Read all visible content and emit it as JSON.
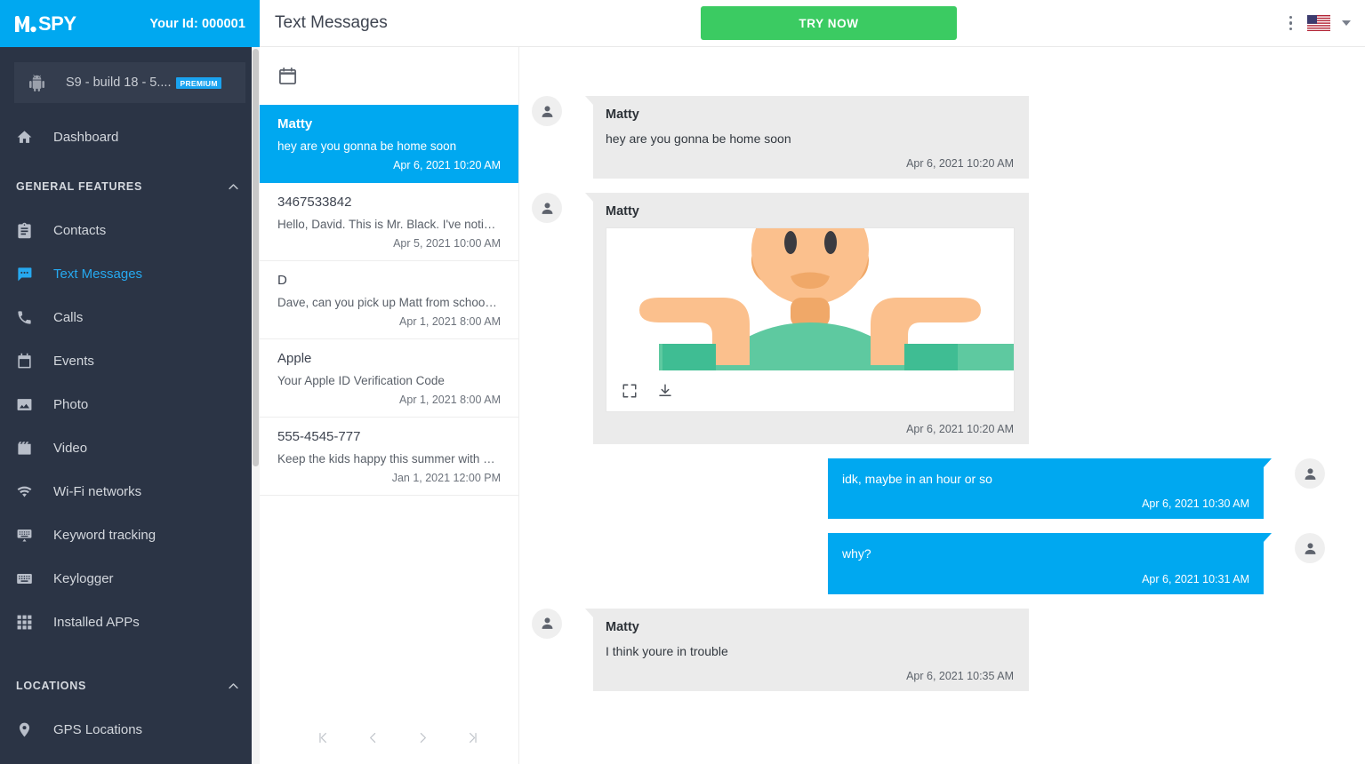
{
  "brand": {
    "logo_text": "SPY",
    "logo_icon": "mspy-m-logo",
    "your_id_label": "Your Id: 000001"
  },
  "device": {
    "icon": "android-icon",
    "name": "S9 - build 18 - 5....",
    "badge": "PREMIUM"
  },
  "sidebar": {
    "items": [
      {
        "label": "Dashboard",
        "icon": "home-icon",
        "active": false
      },
      {
        "label": "Contacts",
        "icon": "contacts-icon",
        "active": false
      },
      {
        "label": "Text Messages",
        "icon": "message-icon",
        "active": true
      },
      {
        "label": "Calls",
        "icon": "phone-icon",
        "active": false
      },
      {
        "label": "Events",
        "icon": "calendar-icon",
        "active": false
      },
      {
        "label": "Photo",
        "icon": "photo-icon",
        "active": false
      },
      {
        "label": "Video",
        "icon": "video-icon",
        "active": false
      },
      {
        "label": "Wi-Fi networks",
        "icon": "wifi-icon",
        "active": false
      },
      {
        "label": "Keyword tracking",
        "icon": "keyword-icon",
        "active": false
      },
      {
        "label": "Keylogger",
        "icon": "keyboard-icon",
        "active": false
      },
      {
        "label": "Installed APPs",
        "icon": "grid-icon",
        "active": false
      },
      {
        "label": "GPS Locations",
        "icon": "pin-icon",
        "active": false
      }
    ],
    "section_general": "GENERAL FEATURES",
    "section_locations": "LOCATIONS",
    "collapse_icon": "chevron-up-icon"
  },
  "header": {
    "title": "Text Messages",
    "try_now_label": "TRY NOW",
    "menu_icon": "kebab-menu-icon",
    "flag_icon": "us-flag-icon",
    "lang_caret": "chevron-down-icon"
  },
  "list_panel": {
    "date_filter_icon": "calendar-icon",
    "threads": [
      {
        "name": "Matty",
        "preview": "hey are you gonna be home soon",
        "date": "Apr 6, 2021 10:20 AM",
        "active": true
      },
      {
        "name": "3467533842",
        "preview": "Hello, David. This is Mr. Black. I've noti…",
        "date": "Apr 5, 2021 10:00 AM",
        "active": false
      },
      {
        "name": "D",
        "preview": "Dave, can you pick up Matt from schoo…",
        "date": "Apr 1, 2021 8:00 AM",
        "active": false
      },
      {
        "name": "Apple",
        "preview": "Your Apple ID Verification Code",
        "date": "Apr 1, 2021 8:00 AM",
        "active": false
      },
      {
        "name": "555-4545-777",
        "preview": "Keep the kids happy this summer with …",
        "date": "Jan 1, 2021 12:00 PM",
        "active": false
      }
    ],
    "pagination": [
      {
        "icon": "first-page-icon",
        "glyph": "|‹"
      },
      {
        "icon": "prev-page-icon",
        "glyph": "‹"
      },
      {
        "icon": "next-page-icon",
        "glyph": "›"
      },
      {
        "icon": "last-page-icon",
        "glyph": "›|"
      }
    ]
  },
  "conversation": {
    "messages": [
      {
        "direction": "in",
        "sender": "Matty",
        "text": "hey are you gonna be home soon",
        "time": "Apr 6, 2021 10:20 AM",
        "attachment": null
      },
      {
        "direction": "in",
        "sender": "Matty",
        "text": "",
        "time": "Apr 6, 2021 10:20 AM",
        "attachment": {
          "type": "image",
          "alt": "shrugging person illustration",
          "expand_icon": "fullscreen-icon",
          "download_icon": "download-icon"
        }
      },
      {
        "direction": "out",
        "sender": "",
        "text": "idk, maybe in an hour or so",
        "time": "Apr 6, 2021 10:30 AM",
        "attachment": null
      },
      {
        "direction": "out",
        "sender": "",
        "text": "why?",
        "time": "Apr 6, 2021 10:31 AM",
        "attachment": null
      },
      {
        "direction": "in",
        "sender": "Matty",
        "text": "I think youre in trouble",
        "time": "Apr 6, 2021 10:35 AM",
        "attachment": null
      }
    ]
  },
  "colors": {
    "accent_blue": "#00a8f0",
    "sidebar_bg": "#2b3445",
    "device_bg": "#343d4e",
    "green_cta": "#3bcb62",
    "bubble_in": "#ebebeb"
  }
}
